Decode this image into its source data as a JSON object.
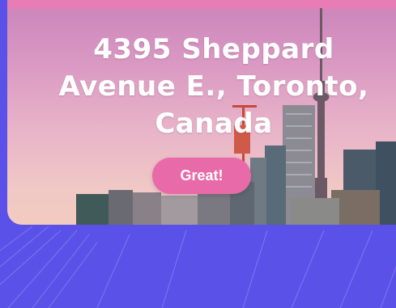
{
  "hero": {
    "headline": "4395 Sheppard Avenue E., Toronto, Canada",
    "button_label": "Great!"
  },
  "colors": {
    "background": "#5a52e8",
    "accent": "#e96aa8",
    "top_bar": "#e87db6"
  },
  "icons": [
    "toronto-skyline-image"
  ]
}
